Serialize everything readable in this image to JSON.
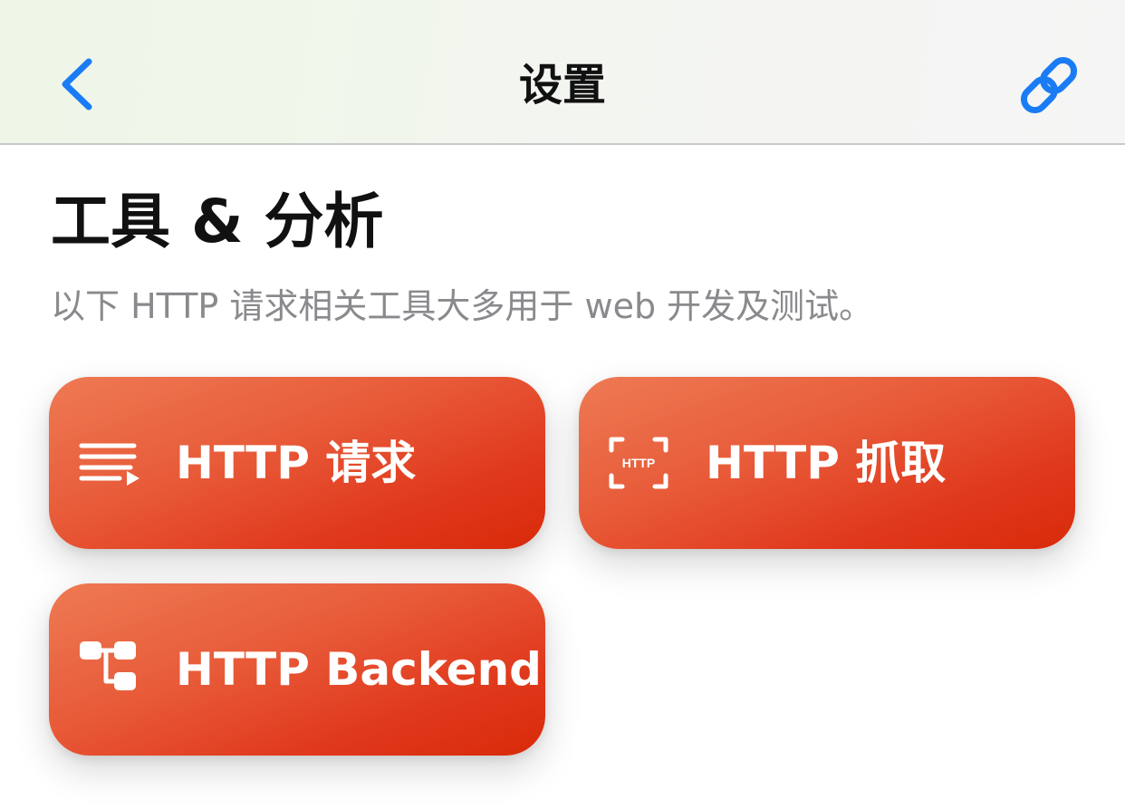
{
  "nav": {
    "title": "设置",
    "back_icon": "chevron-left-icon",
    "link_icon": "link-icon",
    "accent_color": "#1a7cf5"
  },
  "section": {
    "title": "工具 & 分析",
    "subtitle": "以下 HTTP 请求相关工具大多用于 web 开发及测试。"
  },
  "tiles": [
    {
      "label": "HTTP 请求",
      "icon": "request-list-icon"
    },
    {
      "label": "HTTP 抓取",
      "icon": "http-capture-icon",
      "icon_text": "HTTP"
    },
    {
      "label": "HTTP Backend",
      "icon": "backend-tree-icon"
    }
  ],
  "colors": {
    "tile_gradient_start": "#ee7a54",
    "tile_gradient_end": "#d82a0a"
  }
}
